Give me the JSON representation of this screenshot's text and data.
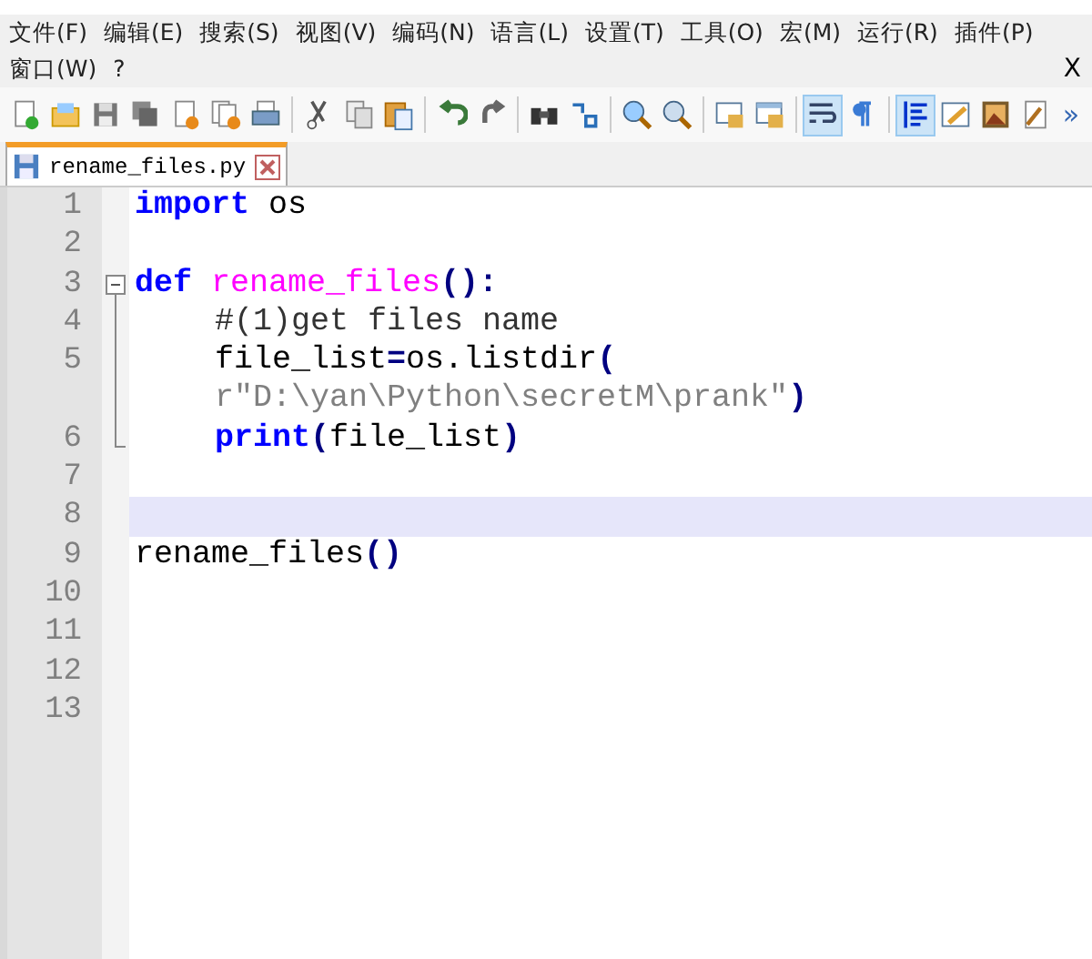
{
  "menu_rows": [
    [
      {
        "label": "文件(F)"
      },
      {
        "label": "编辑(E)"
      },
      {
        "label": "搜索(S)"
      },
      {
        "label": "视图(V)"
      },
      {
        "label": "编码(N)"
      },
      {
        "label": "语言(L)"
      },
      {
        "label": "设置(T)"
      },
      {
        "label": "工具(O)"
      },
      {
        "label": "宏(M)"
      },
      {
        "label": "运行(R)"
      },
      {
        "label": "插件(P)"
      }
    ],
    [
      {
        "label": "窗口(W)"
      },
      {
        "label": "?"
      }
    ]
  ],
  "close_doc": "X",
  "toolbar_groups": [
    [
      {
        "pressed": false
      },
      {
        "pressed": false
      },
      {
        "pressed": false
      },
      {
        "pressed": false
      },
      {
        "pressed": false
      },
      {
        "pressed": false
      },
      {
        "pressed": false
      }
    ],
    [
      {
        "pressed": false
      },
      {
        "pressed": false
      },
      {
        "pressed": false
      }
    ],
    [
      {
        "pressed": false
      },
      {
        "pressed": false
      }
    ],
    [
      {
        "pressed": false
      },
      {
        "pressed": false
      }
    ],
    [
      {
        "pressed": false
      },
      {
        "pressed": false
      }
    ],
    [
      {
        "pressed": false
      },
      {
        "pressed": false
      }
    ],
    [
      {
        "pressed": true
      },
      {
        "pressed": false
      }
    ],
    [
      {
        "pressed": true
      },
      {
        "pressed": false
      },
      {
        "pressed": false
      },
      {
        "pressed": false
      }
    ]
  ],
  "toolbar_more": "»",
  "tabs": [
    {
      "label": "rename_files.py",
      "selected": true
    }
  ],
  "lines": [
    {
      "number": "1",
      "current": false,
      "visual_lines": [
        {
          "indented": false,
          "tokens": [
            {
              "kind": "keyword",
              "text": "import "
            },
            {
              "kind": "plain",
              "text": "os"
            }
          ]
        }
      ]
    },
    {
      "number": "2",
      "current": false
    },
    {
      "number": "3",
      "current": false,
      "expanded": true,
      "visual_lines": [
        {
          "indented": false,
          "tokens": [
            {
              "kind": "keyword",
              "text": "def "
            },
            {
              "kind": "function",
              "text": "rename_files"
            },
            {
              "kind": "operator",
              "text": "():"
            }
          ]
        }
      ],
      "children": [
        {
          "number": "4",
          "current": false,
          "visual_lines": [
            {
              "indented": true,
              "tokens": [
                {
                  "kind": "comment",
                  "text": "#(1)get files name"
                }
              ]
            }
          ]
        },
        {
          "number": "5",
          "current": false,
          "visual_lines": [
            {
              "indented": true,
              "tokens": [
                {
                  "kind": "plain",
                  "text": "file_list"
                },
                {
                  "kind": "operator",
                  "text": "="
                },
                {
                  "kind": "plain",
                  "text": "os.listdir"
                },
                {
                  "kind": "operator",
                  "text": "("
                }
              ]
            },
            {
              "indented": true,
              "tokens": [
                {
                  "kind": "string",
                  "text": "r\"D:\\yan\\Python\\secretM\\prank\""
                },
                {
                  "kind": "operator",
                  "text": ")"
                }
              ]
            }
          ]
        },
        {
          "number": "6",
          "current": false,
          "visual_lines": [
            {
              "indented": true,
              "tokens": [
                {
                  "kind": "keyword",
                  "text": "print"
                },
                {
                  "kind": "operator",
                  "text": "("
                },
                {
                  "kind": "plain",
                  "text": "file_list"
                },
                {
                  "kind": "operator",
                  "text": ")"
                }
              ]
            }
          ]
        }
      ]
    },
    {
      "number": "7",
      "current": false
    },
    {
      "number": "8",
      "current": true
    },
    {
      "number": "9",
      "current": false,
      "visual_lines": [
        {
          "indented": false,
          "tokens": [
            {
              "kind": "plain",
              "text": "rename_files"
            },
            {
              "kind": "operator",
              "text": "()"
            }
          ]
        }
      ]
    },
    {
      "number": "10",
      "current": false
    },
    {
      "number": "11",
      "current": false
    },
    {
      "number": "12",
      "current": false
    },
    {
      "number": "13",
      "current": false
    }
  ]
}
